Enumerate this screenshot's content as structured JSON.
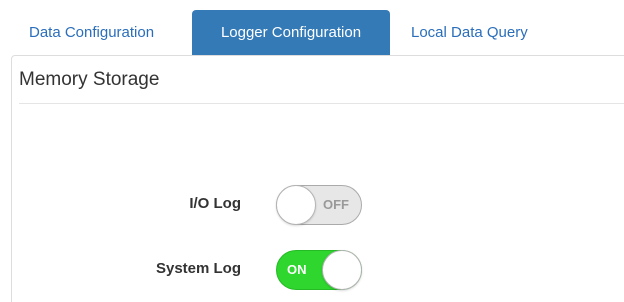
{
  "tabs": [
    {
      "label": "Data Configuration",
      "active": false
    },
    {
      "label": "Logger Configuration",
      "active": true
    },
    {
      "label": "Local Data Query",
      "active": false
    }
  ],
  "section": {
    "title": "Memory Storage"
  },
  "fields": [
    {
      "label": "I/O Log",
      "toggle_text": "OFF",
      "state": "off"
    },
    {
      "label": "System Log",
      "toggle_text": "ON",
      "state": "on"
    }
  ],
  "colors": {
    "tab_active_bg": "#337ab7",
    "tab_text": "#2a6ebb",
    "toggle_on": "#2ed62e",
    "toggle_off": "#e7e7e7"
  }
}
